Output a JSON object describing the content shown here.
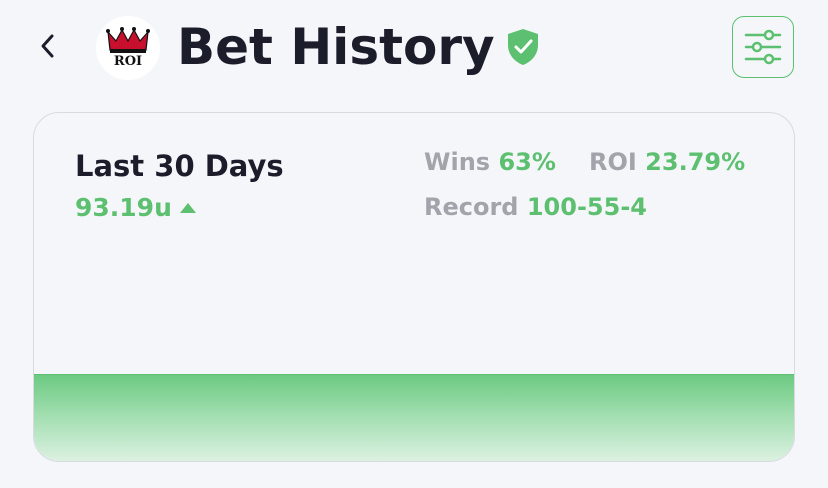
{
  "header": {
    "back_label": "Back",
    "logo_text": "ROI",
    "title": "Bet History",
    "verified_icon": "shield-check-icon",
    "filter_icon": "sliders-icon"
  },
  "summary": {
    "period": "Last 30 Days",
    "units": "93.19u",
    "trend": "up",
    "wins_label": "Wins",
    "wins_value": "63%",
    "roi_label": "ROI",
    "roi_value": "23.79%",
    "record_label": "Record",
    "record_value": "100-55-4"
  },
  "colors": {
    "accent": "#5cc070",
    "title": "#1c1d2b",
    "muted": "#a2a4ab",
    "background": "#f5f6fa"
  }
}
